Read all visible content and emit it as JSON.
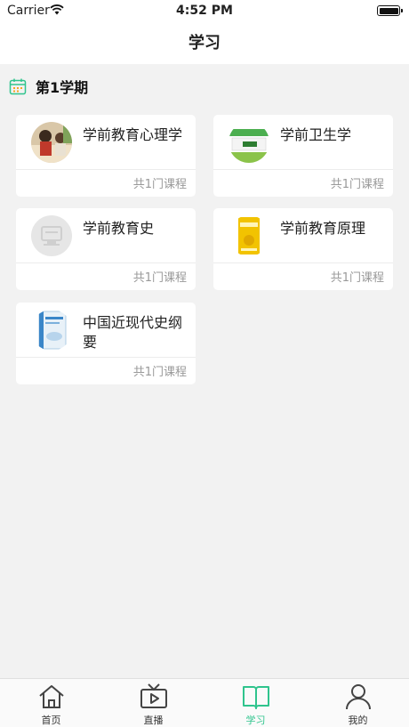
{
  "status_bar": {
    "carrier": "Carrier",
    "time": "4:52 PM"
  },
  "nav": {
    "title": "学习"
  },
  "semester": {
    "label": "第1学期"
  },
  "courses": [
    {
      "title": "学前教育心理学",
      "count": "共1门课程",
      "thumb": "photo-children"
    },
    {
      "title": "学前卫生学",
      "count": "共1门课程",
      "thumb": "book-cover-green"
    },
    {
      "title": "学前教育史",
      "count": "共1门课程",
      "thumb": "placeholder-gray"
    },
    {
      "title": "学前教育原理",
      "count": "共1门课程",
      "thumb": "book-cover-yellow"
    },
    {
      "title": "中国近现代史纲要",
      "count": "共1门课程",
      "thumb": "book-cover-blue"
    }
  ],
  "tabs": [
    {
      "label": "首页",
      "icon": "home-icon"
    },
    {
      "label": "直播",
      "icon": "tv-icon"
    },
    {
      "label": "学习",
      "icon": "book-icon",
      "active": true
    },
    {
      "label": "我的",
      "icon": "user-icon"
    }
  ],
  "colors": {
    "accent": "#2fc48d",
    "background": "#f2f2f2"
  }
}
